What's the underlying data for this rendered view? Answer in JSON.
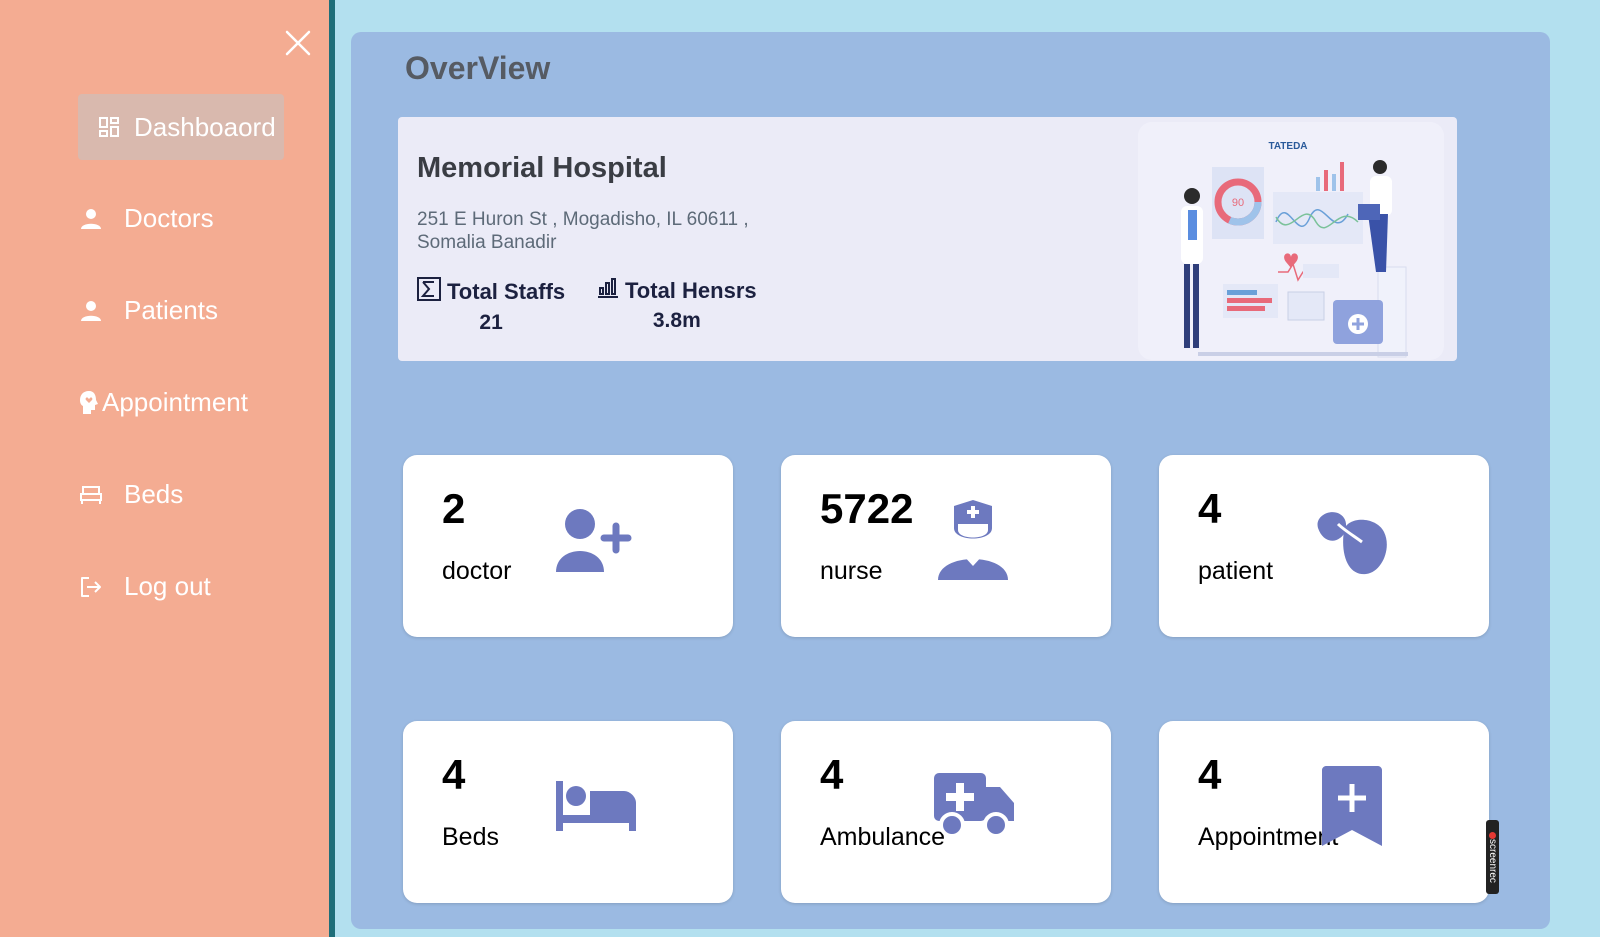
{
  "sidebar": {
    "items": [
      {
        "label": "Dashboaord",
        "icon": "dashboard-grid-icon"
      },
      {
        "label": "Doctors",
        "icon": "person-icon"
      },
      {
        "label": "Patients",
        "icon": "person-icon"
      },
      {
        "label": "Appointment",
        "icon": "head-heart-icon"
      },
      {
        "label": "Beds",
        "icon": "bed-outline-icon"
      },
      {
        "label": "Log out",
        "icon": "logout-icon"
      }
    ]
  },
  "main": {
    "title": "OverView",
    "hospital": {
      "name": "Memorial Hospital",
      "address": "251 E Huron St , Mogadisho, IL 60611 , Somalia Banadir",
      "stats": [
        {
          "label": "Total Staffs",
          "value": "21",
          "icon": "sigma-icon"
        },
        {
          "label": "Total Hensrs",
          "value": "3.8m",
          "icon": "bar-chart-icon"
        }
      ],
      "illustration_logo": "TATEDA",
      "illustration_gauge": "90"
    },
    "cards": [
      {
        "value": "2",
        "label": "doctor",
        "icon": "user-plus-icon"
      },
      {
        "value": "5722",
        "label": "nurse",
        "icon": "nurse-icon"
      },
      {
        "value": "4",
        "label": "patient",
        "icon": "lungs-icon"
      },
      {
        "value": "4",
        "label": "Beds",
        "icon": "bed-icon"
      },
      {
        "value": "4",
        "label": "Ambulance",
        "icon": "ambulance-icon"
      },
      {
        "value": "4",
        "label": "Appointment",
        "icon": "bookmark-plus-icon"
      }
    ]
  },
  "colors": {
    "sidebar_bg": "#f4ac92",
    "panel_bg": "#9bbae2",
    "page_bg": "#b3e0ef",
    "icon_accent": "#6d79bf"
  },
  "watermark": "screenrec"
}
